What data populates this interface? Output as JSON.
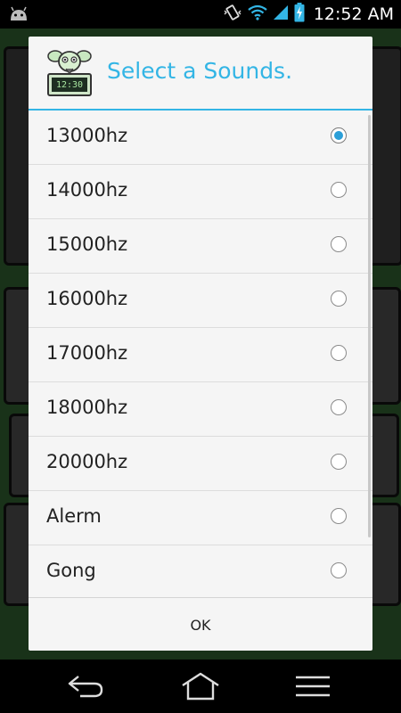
{
  "status_bar": {
    "time": "12:52 AM",
    "icons": [
      "android-icon",
      "vibrate-icon",
      "wifi-icon",
      "signal-icon",
      "battery-charging-icon"
    ]
  },
  "dialog": {
    "title": "Select a Sounds.",
    "icon": "alarm-clock-app-icon",
    "clock_digits": "12:30",
    "accent_color": "#33b5e5",
    "options": [
      {
        "label": "13000hz",
        "selected": true
      },
      {
        "label": "14000hz",
        "selected": false
      },
      {
        "label": "15000hz",
        "selected": false
      },
      {
        "label": "16000hz",
        "selected": false
      },
      {
        "label": "17000hz",
        "selected": false
      },
      {
        "label": "18000hz",
        "selected": false
      },
      {
        "label": "20000hz",
        "selected": false
      },
      {
        "label": "Alerm",
        "selected": false
      },
      {
        "label": "Gong",
        "selected": false
      }
    ],
    "ok_label": "OK"
  },
  "nav_bar": {
    "buttons": [
      "back-icon",
      "home-icon",
      "menu-icon"
    ]
  }
}
